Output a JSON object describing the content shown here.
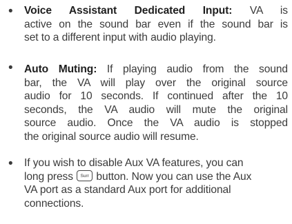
{
  "items": [
    {
      "title": "Voice Assistant Dedicated Input:",
      "lines": [
        " VA is",
        "active on the sound bar even if the sound bar is",
        "set to a different input with audio playing."
      ]
    },
    {
      "title": "Auto Muting:",
      "lines": [
        " If playing audio from the sound",
        "bar, the VA will play over the original source",
        "audio for 10 seconds. If continued after the 10",
        "seconds, the VA audio will mute the original",
        "source audio. Once the VA audio is stopped",
        "the original source audio will resume."
      ]
    },
    {
      "lines": [
        "If you wish to disable Aux VA features, you can",
        "long press",
        "button. Now you can use the Aux",
        "VA port as a standard Aux port for additional",
        "connections."
      ]
    }
  ],
  "surr_button": {
    "label": "Surr",
    "icon": "surr-button-icon"
  }
}
